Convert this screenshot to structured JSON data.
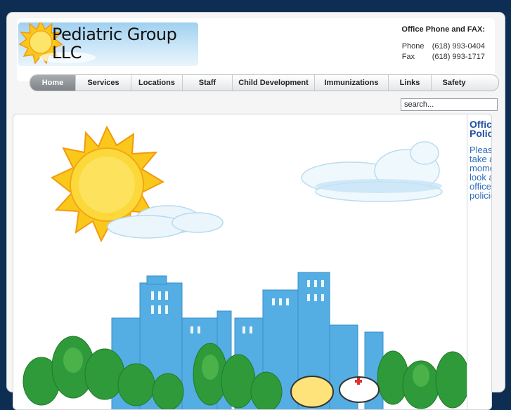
{
  "logo": {
    "text": "Pediatric Group LLC",
    "alt_name": "Pediatric Group LLC logo"
  },
  "contact": {
    "title": "Office Phone and FAX:",
    "phone_label": "Phone",
    "phone_value": "(618) 993-0404",
    "fax_label": "Fax",
    "fax_value": "(618) 993-1717"
  },
  "nav": {
    "items": [
      {
        "label": "Home",
        "active": true
      },
      {
        "label": "Services"
      },
      {
        "label": "Locations"
      },
      {
        "label": "Staff"
      },
      {
        "label": "Child Development"
      },
      {
        "label": "Immunizations"
      },
      {
        "label": "Links"
      },
      {
        "label": "Safety"
      }
    ]
  },
  "search": {
    "value": "search..."
  },
  "sidebar": {
    "title": "Office Policies",
    "text": "Please take a moment to look at our office policies"
  },
  "colors": {
    "background": "#0e2d52",
    "nav_active": "#8a8e93",
    "sidebar_title": "#1f4fa0",
    "sidebar_text": "#2e6db8",
    "sun": "#f6c21a",
    "buildings": "#55aee3",
    "trees": "#2f9a3a"
  }
}
